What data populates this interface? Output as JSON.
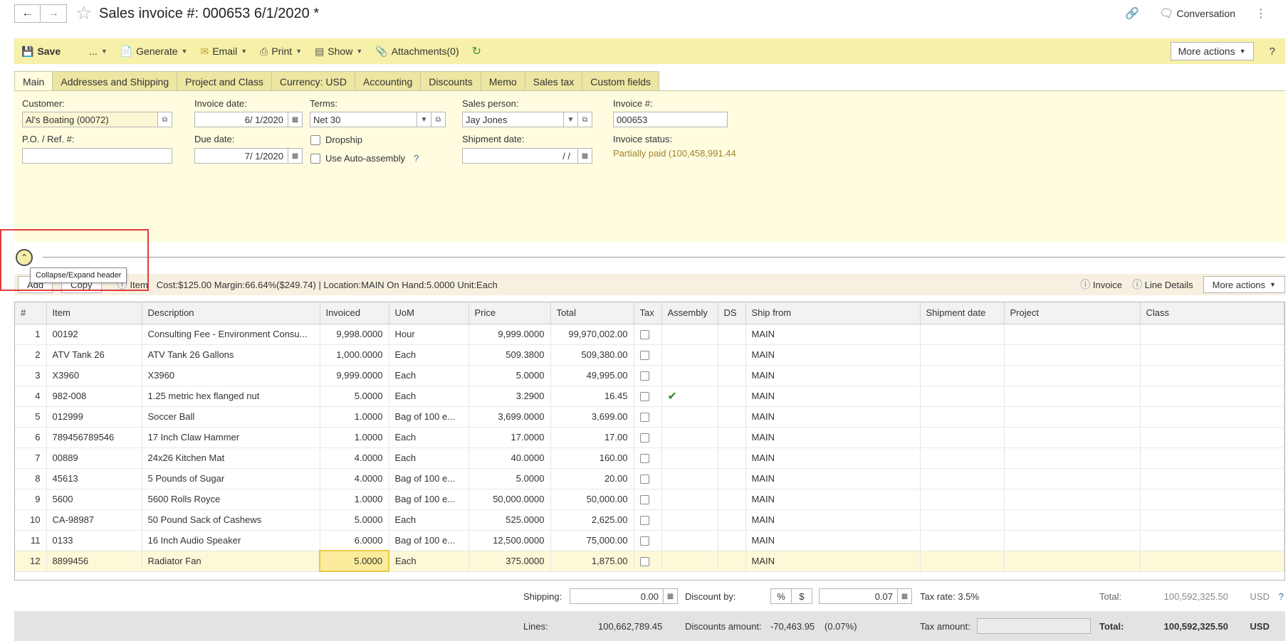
{
  "header": {
    "title": "Sales invoice #: 000653 6/1/2020 *",
    "back_icon": "arrow-left-icon",
    "forward_icon": "arrow-right-icon",
    "conversation_label": "Conversation"
  },
  "toolbar": {
    "save": "Save",
    "ellipsis": "...",
    "generate": "Generate",
    "email": "Email",
    "print": "Print",
    "show": "Show",
    "attachments": "Attachments(0)",
    "more_actions": "More actions",
    "help": "?"
  },
  "tabs": [
    "Main",
    "Addresses and Shipping",
    "Project and Class",
    "Currency: USD",
    "Accounting",
    "Discounts",
    "Memo",
    "Sales tax",
    "Custom fields"
  ],
  "form": {
    "customer_label": "Customer:",
    "customer_value": "Al's Boating (00072)",
    "po_label": "P.O. / Ref. #:",
    "po_value": "",
    "invoice_date_label": "Invoice date:",
    "invoice_date_value": "6/ 1/2020",
    "due_date_label": "Due date:",
    "due_date_value": "7/ 1/2020",
    "terms_label": "Terms:",
    "terms_value": "Net 30",
    "dropship_label": "Dropship",
    "auto_assembly_label": "Use Auto-assembly",
    "auto_assembly_help": "?",
    "sales_person_label": "Sales person:",
    "sales_person_value": "Jay Jones",
    "shipment_date_label": "Shipment date:",
    "shipment_date_value": "/ /",
    "invoice_no_label": "Invoice #:",
    "invoice_no_value": "000653",
    "invoice_status_label": "Invoice status:",
    "invoice_status_value": "Partially paid (100,458,991.44"
  },
  "collapse": {
    "tooltip": "Collapse/Expand header"
  },
  "grid_toolbar": {
    "add": "Add",
    "copy": "Copy",
    "item_label": "Item",
    "item_info": "Cost:$125.00 Margin:66.64%($249.74) | Location:MAIN On Hand:5.0000 Unit:Each",
    "invoice": "Invoice",
    "line_details": "Line Details",
    "more_actions": "More actions"
  },
  "table": {
    "columns": [
      "#",
      "Item",
      "Description",
      "Invoiced",
      "UoM",
      "Price",
      "Total",
      "Tax",
      "Assembly",
      "DS",
      "Ship from",
      "Shipment date",
      "Project",
      "Class"
    ],
    "rows": [
      {
        "n": "1",
        "item": "00192",
        "desc": "Consulting Fee - Environment Consu...",
        "inv": "9,998.0000",
        "uom": "Hour",
        "price": "9,999.0000",
        "total": "99,970,002.00",
        "assembly": false,
        "ship": "MAIN"
      },
      {
        "n": "2",
        "item": " ATV Tank 26",
        "desc": "ATV Tank 26 Gallons",
        "inv": "1,000.0000",
        "uom": "Each",
        "price": "509.3800",
        "total": "509,380.00",
        "assembly": false,
        "ship": "MAIN"
      },
      {
        "n": "3",
        "item": "X3960",
        "desc": "X3960",
        "inv": "9,999.0000",
        "uom": "Each",
        "price": "5.0000",
        "total": "49,995.00",
        "assembly": false,
        "ship": "MAIN"
      },
      {
        "n": "4",
        "item": "982-008",
        "desc": "1.25 metric hex flanged nut",
        "inv": "5.0000",
        "uom": "Each",
        "price": "3.2900",
        "total": "16.45",
        "assembly": true,
        "ship": "MAIN"
      },
      {
        "n": "5",
        "item": "012999",
        "desc": "Soccer Ball",
        "inv": "1.0000",
        "uom": "Bag of 100 e...",
        "price": "3,699.0000",
        "total": "3,699.00",
        "assembly": false,
        "ship": "MAIN"
      },
      {
        "n": "6",
        "item": "789456789546",
        "desc": "17 Inch Claw Hammer",
        "inv": "1.0000",
        "uom": "Each",
        "price": "17.0000",
        "total": "17.00",
        "assembly": false,
        "ship": "MAIN"
      },
      {
        "n": "7",
        "item": "00889",
        "desc": "24x26 Kitchen Mat",
        "inv": "4.0000",
        "uom": "Each",
        "price": "40.0000",
        "total": "160.00",
        "assembly": false,
        "ship": "MAIN"
      },
      {
        "n": "8",
        "item": "45613",
        "desc": "5 Pounds of Sugar",
        "inv": "4.0000",
        "uom": "Bag of 100 e...",
        "price": "5.0000",
        "total": "20.00",
        "assembly": false,
        "ship": "MAIN"
      },
      {
        "n": "9",
        "item": "5600",
        "desc": "5600 Rolls Royce",
        "inv": "1.0000",
        "uom": "Bag of 100 e...",
        "price": "50,000.0000",
        "total": "50,000.00",
        "assembly": false,
        "ship": "MAIN"
      },
      {
        "n": "10",
        "item": "CA-98987",
        "desc": "50 Pound Sack of Cashews",
        "inv": "5.0000",
        "uom": "Each",
        "price": "525.0000",
        "total": "2,625.00",
        "assembly": false,
        "ship": "MAIN"
      },
      {
        "n": "11",
        "item": "0133",
        "desc": "16 Inch Audio Speaker",
        "inv": "6.0000",
        "uom": "Bag of 100 e...",
        "price": "12,500.0000",
        "total": "75,000.00",
        "assembly": false,
        "ship": "MAIN"
      },
      {
        "n": "12",
        "item": "8899456",
        "desc": "Radiator Fan",
        "inv": "5.0000",
        "uom": "Each",
        "price": "375.0000",
        "total": "1,875.00",
        "assembly": false,
        "ship": "MAIN"
      }
    ]
  },
  "footer": {
    "shipping_label": "Shipping:",
    "shipping_value": "0.00",
    "discount_by_label": "Discount by:",
    "discount_pct": "%",
    "discount_amt": "$",
    "discount_value": "0.07",
    "tax_rate": "Tax rate: 3.5%",
    "total_label": "Total:",
    "total_value": "100,592,325.50",
    "currency": "USD",
    "help": "?",
    "lines_label": "Lines:",
    "lines_value": "100,662,789.45",
    "discounts_amount_label": "Discounts amount:",
    "discounts_amount_value": "-70,463.95",
    "discounts_amount_pct": "(0.07%)",
    "tax_amount_label": "Tax amount:",
    "total2_label": "Total:",
    "total2_value": "100,592,325.50",
    "currency2": "USD"
  }
}
